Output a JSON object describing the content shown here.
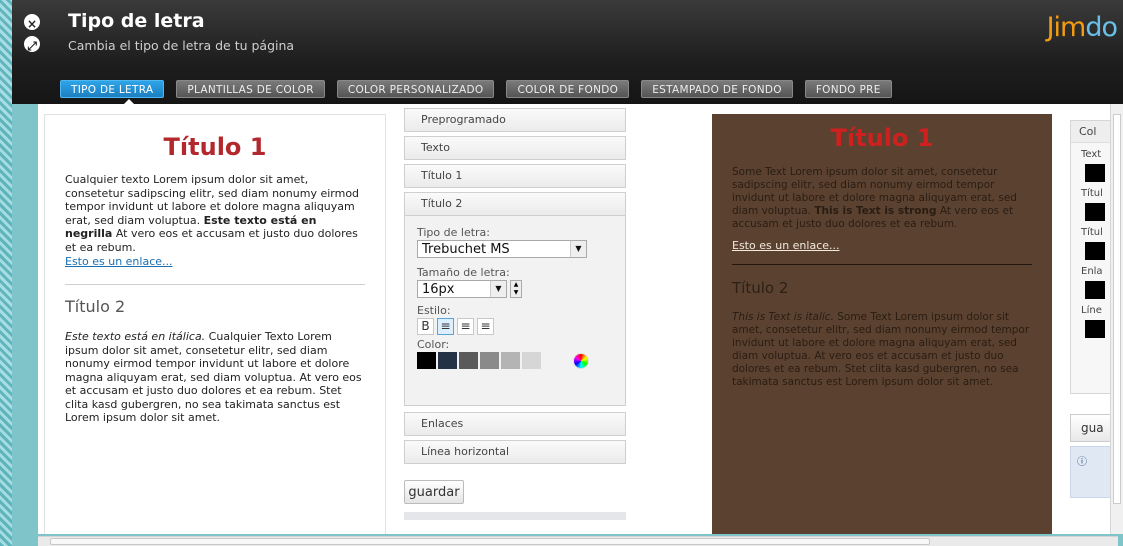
{
  "header": {
    "title": "Tipo de letra",
    "subtitle": "Cambia el tipo de letra de tu página",
    "brand_a": "Jim",
    "brand_b": "do",
    "close_icon": "close-icon",
    "expand_icon": "expand-icon"
  },
  "tabs": [
    {
      "label": "TIPO DE LETRA",
      "active": true
    },
    {
      "label": "PLANTILLAS DE COLOR",
      "active": false
    },
    {
      "label": "COLOR PERSONALIZADO",
      "active": false
    },
    {
      "label": "COLOR DE FONDO",
      "active": false
    },
    {
      "label": "ESTAMPADO DE FONDO",
      "active": false
    },
    {
      "label": "FONDO PRE",
      "active": false
    }
  ],
  "preview_light": {
    "title1": "Título 1",
    "para1_a": "Cualquier texto Lorem ipsum dolor sit amet, consetetur sadipscing elitr, sed diam nonumy eirmod tempor invidunt ut labore et dolore magna aliquyam erat, sed diam voluptua. ",
    "para1_bold": "Este texto está en negrilla",
    "para1_b": " At vero eos et accusam et justo duo dolores et ea rebum.",
    "link": "Esto es un enlace...",
    "title2": "Título 2",
    "para2_italic": "Este texto está en itálica.",
    "para2_rest": " Cualquier Texto Lorem ipsum dolor sit amet, consetetur elitr, sed diam nonumy eirmod tempor invidunt ut labore et dolore magna aliquyam erat, sed diam voluptua. At vero eos et accusam et justo duo dolores et ea rebum. Stet clita kasd gubergren, no sea takimata sanctus est Lorem ipsum dolor sit amet."
  },
  "settings": {
    "items_top": [
      "Preprogramado",
      "Texto",
      "Título 1",
      "Título 2"
    ],
    "font_label": "Tipo de letra:",
    "font_value": "Trebuchet MS",
    "size_label": "Tamaño de letra:",
    "size_value": "16px",
    "style_label": "Estilo:",
    "style_bold": "B",
    "color_label": "Color:",
    "swatch_colors": [
      "#000000",
      "#233345",
      "#5a5a5a",
      "#8a8a8a",
      "#b4b4b4",
      "#d6d6d6"
    ],
    "items_bottom": [
      "Enlaces",
      "Línea horizontal"
    ],
    "save": "guardar"
  },
  "preview_dark": {
    "title1": "Título 1",
    "para1_a": "Some Text Lorem ipsum dolor sit amet, consetetur sadipscing elitr, sed diam nonumy eirmod tempor invidunt ut labore et dolore magna aliquyam erat, sed diam voluptua. ",
    "para1_bold": "This is Text is strong",
    "para1_b": " At vero eos et accusam et justo duo dolores et ea rebum.",
    "link": "Esto es un enlace...",
    "title2": "Título 2",
    "para2_italic": "This is Text is italic.",
    "para2_rest": " Some Text Lorem ipsum dolor sit amet, consetetur elitr, sed diam nonumy eirmod tempor invidunt ut labore et dolore magna aliquyam erat, sed diam voluptua. At vero eos et accusam et justo duo dolores et ea rebum. Stet clita kasd gubergren, no sea takimata sanctus est Lorem ipsum dolor sit amet."
  },
  "right_col": {
    "head": "Col",
    "labels": [
      "Text",
      "Títul",
      "Títul",
      "Enla",
      "Líne"
    ],
    "save": "gua",
    "info_icon": "info-icon"
  }
}
